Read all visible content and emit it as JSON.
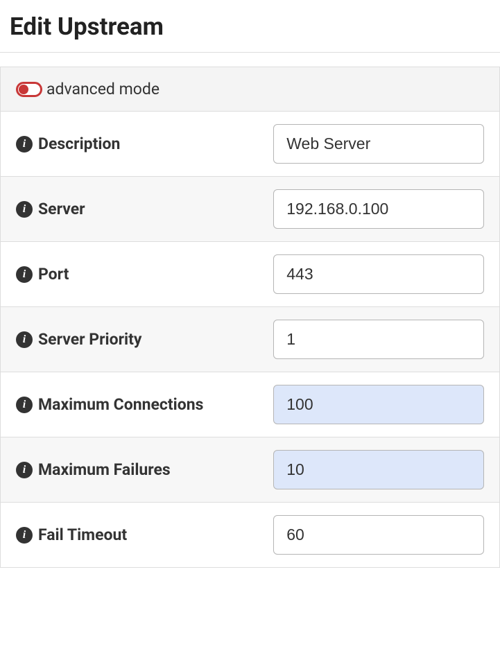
{
  "title": "Edit Upstream",
  "advanced_mode_label": "advanced mode",
  "fields": {
    "description": {
      "label": "Description",
      "value": "Web Server",
      "highlight": false
    },
    "server": {
      "label": "Server",
      "value": "192.168.0.100",
      "highlight": false
    },
    "port": {
      "label": "Port",
      "value": "443",
      "highlight": false
    },
    "priority": {
      "label": "Server Priority",
      "value": "1",
      "highlight": false
    },
    "max_conn": {
      "label": "Maximum Connections",
      "value": "100",
      "highlight": true
    },
    "max_fail": {
      "label": "Maximum Failures",
      "value": "10",
      "highlight": true
    },
    "fail_timeout": {
      "label": "Fail Timeout",
      "value": "60",
      "highlight": false
    }
  }
}
